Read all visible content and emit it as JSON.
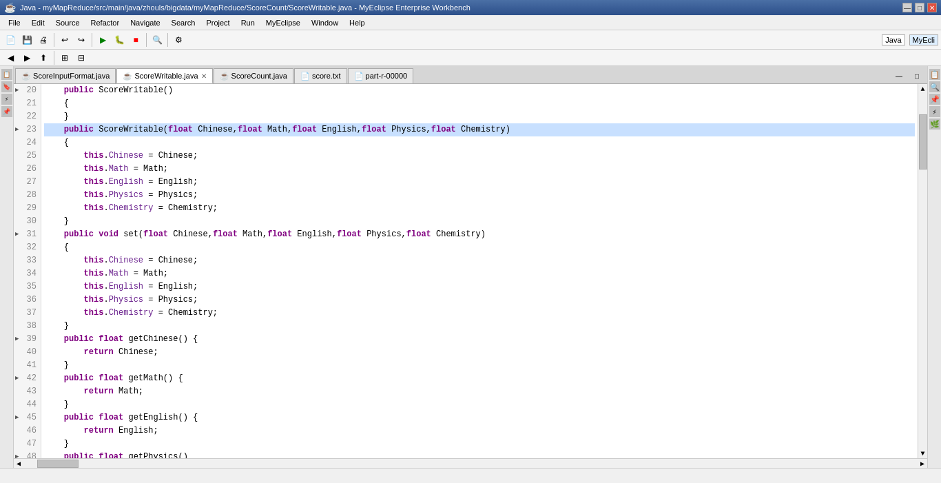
{
  "titlebar": {
    "title": "Java - myMapReduce/src/main/java/zhouls/bigdata/myMapReduce/ScoreCount/ScoreWritable.java - MyEclipse Enterprise Workbench",
    "controls": [
      "—",
      "□",
      "✕"
    ]
  },
  "menubar": {
    "items": [
      "File",
      "Edit",
      "Source",
      "Refactor",
      "Navigate",
      "Search",
      "Project",
      "Run",
      "MyEclipse",
      "Window",
      "Help"
    ]
  },
  "tabs": [
    {
      "label": "ScoreInputFormat.java",
      "active": false,
      "closable": false
    },
    {
      "label": "ScoreWritable.java",
      "active": true,
      "closable": true
    },
    {
      "label": "ScoreCount.java",
      "active": false,
      "closable": false
    },
    {
      "label": "score.txt",
      "active": false,
      "closable": false
    },
    {
      "label": "part-r-00000",
      "active": false,
      "closable": false
    }
  ],
  "code": {
    "lines": [
      {
        "num": "20",
        "arrow": true,
        "text": "    public ScoreWritable()",
        "highlighted": false
      },
      {
        "num": "21",
        "arrow": false,
        "text": "    {",
        "highlighted": false
      },
      {
        "num": "22",
        "arrow": false,
        "text": "    }",
        "highlighted": false
      },
      {
        "num": "23",
        "arrow": true,
        "text": "    public ScoreWritable(float Chinese,float Math,float English,float Physics,float Chemistry)",
        "highlighted": true
      },
      {
        "num": "24",
        "arrow": false,
        "text": "    {",
        "highlighted": false
      },
      {
        "num": "25",
        "arrow": false,
        "text": "        this.Chinese = Chinese;",
        "highlighted": false
      },
      {
        "num": "26",
        "arrow": false,
        "text": "        this.Math = Math;",
        "highlighted": false
      },
      {
        "num": "27",
        "arrow": false,
        "text": "        this.English = English;",
        "highlighted": false
      },
      {
        "num": "28",
        "arrow": false,
        "text": "        this.Physics = Physics;",
        "highlighted": false
      },
      {
        "num": "29",
        "arrow": false,
        "text": "        this.Chemistry = Chemistry;",
        "highlighted": false
      },
      {
        "num": "30",
        "arrow": false,
        "text": "    }",
        "highlighted": false
      },
      {
        "num": "31",
        "arrow": true,
        "text": "    public void set(float Chinese,float Math,float English,float Physics,float Chemistry)",
        "highlighted": false
      },
      {
        "num": "32",
        "arrow": false,
        "text": "    {",
        "highlighted": false
      },
      {
        "num": "33",
        "arrow": false,
        "text": "        this.Chinese = Chinese;",
        "highlighted": false
      },
      {
        "num": "34",
        "arrow": false,
        "text": "        this.Math = Math;",
        "highlighted": false
      },
      {
        "num": "35",
        "arrow": false,
        "text": "        this.English = English;",
        "highlighted": false
      },
      {
        "num": "36",
        "arrow": false,
        "text": "        this.Physics = Physics;",
        "highlighted": false
      },
      {
        "num": "37",
        "arrow": false,
        "text": "        this.Chemistry = Chemistry;",
        "highlighted": false
      },
      {
        "num": "38",
        "arrow": false,
        "text": "    }",
        "highlighted": false
      },
      {
        "num": "39",
        "arrow": true,
        "text": "    public float getChinese() {",
        "highlighted": false
      },
      {
        "num": "40",
        "arrow": false,
        "text": "        return Chinese;",
        "highlighted": false
      },
      {
        "num": "41",
        "arrow": false,
        "text": "    }",
        "highlighted": false
      },
      {
        "num": "42",
        "arrow": true,
        "text": "    public float getMath() {",
        "highlighted": false
      },
      {
        "num": "43",
        "arrow": false,
        "text": "        return Math;",
        "highlighted": false
      },
      {
        "num": "44",
        "arrow": false,
        "text": "    }",
        "highlighted": false
      },
      {
        "num": "45",
        "arrow": true,
        "text": "    public float getEnglish() {",
        "highlighted": false
      },
      {
        "num": "46",
        "arrow": false,
        "text": "        return English;",
        "highlighted": false
      },
      {
        "num": "47",
        "arrow": false,
        "text": "    }",
        "highlighted": false
      },
      {
        "num": "48",
        "arrow": true,
        "text": "    public float getPhysics()",
        "highlighted": false
      }
    ]
  },
  "statusbar": {
    "java_label": "Java",
    "myeclipse_label": "MyEcli"
  }
}
